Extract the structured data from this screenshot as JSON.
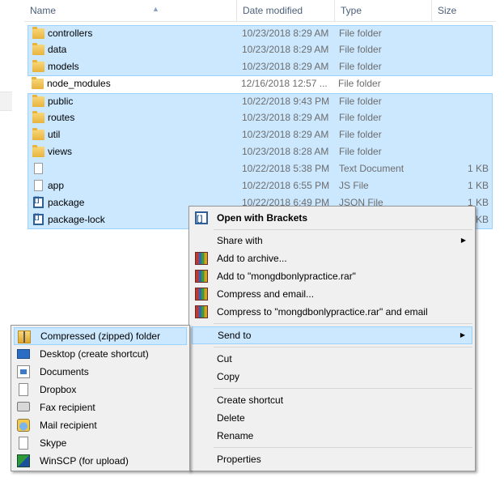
{
  "header": {
    "name": "Name",
    "date_modified": "Date modified",
    "type": "Type",
    "size": "Size"
  },
  "files": [
    {
      "name": "controllers",
      "date": "10/23/2018 8:29 AM",
      "type": "File folder",
      "size": "",
      "icon": "folder-icon",
      "selected": true
    },
    {
      "name": "data",
      "date": "10/23/2018 8:29 AM",
      "type": "File folder",
      "size": "",
      "icon": "folder-icon",
      "selected": true
    },
    {
      "name": "models",
      "date": "10/23/2018 8:29 AM",
      "type": "File folder",
      "size": "",
      "icon": "folder-icon",
      "selected": true
    },
    {
      "name": "node_modules",
      "date": "12/16/2018 12:57 ...",
      "type": "File folder",
      "size": "",
      "icon": "folder-icon",
      "selected": false
    },
    {
      "name": "public",
      "date": "10/22/2018 9:43 PM",
      "type": "File folder",
      "size": "",
      "icon": "folder-icon",
      "selected": true
    },
    {
      "name": "routes",
      "date": "10/23/2018 8:29 AM",
      "type": "File folder",
      "size": "",
      "icon": "folder-icon",
      "selected": true
    },
    {
      "name": "util",
      "date": "10/23/2018 8:29 AM",
      "type": "File folder",
      "size": "",
      "icon": "folder-icon",
      "selected": true
    },
    {
      "name": "views",
      "date": "10/23/2018 8:28 AM",
      "type": "File folder",
      "size": "",
      "icon": "folder-icon",
      "selected": true
    },
    {
      "name": "",
      "date": "10/22/2018 5:38 PM",
      "type": "Text Document",
      "size": "1 KB",
      "icon": "text-document-icon",
      "selected": true
    },
    {
      "name": "app",
      "date": "10/22/2018 6:55 PM",
      "type": "JS File",
      "size": "1 KB",
      "icon": "js-file-icon",
      "selected": true
    },
    {
      "name": "package",
      "date": "10/22/2018 6:49 PM",
      "type": "JSON File",
      "size": "1 KB",
      "icon": "brackets-file-icon",
      "selected": true
    },
    {
      "name": "package-lock",
      "date": "",
      "type": "",
      "size": "6 KB",
      "icon": "brackets-file-icon",
      "selected": true
    }
  ],
  "context_menu": {
    "open_with": "Open with Brackets",
    "share_with": "Share with",
    "add_to_archive": "Add to archive...",
    "add_to_rar": "Add to \"mongdbonlypractice.rar\"",
    "compress_email": "Compress and email...",
    "compress_rar_email": "Compress to \"mongdbonlypractice.rar\" and email",
    "send_to": "Send to",
    "cut": "Cut",
    "copy": "Copy",
    "create_shortcut": "Create shortcut",
    "delete": "Delete",
    "rename": "Rename",
    "properties": "Properties",
    "submenu_arrow": "▶"
  },
  "send_to_menu": {
    "zip": "Compressed (zipped) folder",
    "desktop": "Desktop (create shortcut)",
    "documents": "Documents",
    "dropbox": "Dropbox",
    "fax": "Fax recipient",
    "mail": "Mail recipient",
    "skype": "Skype",
    "winscp": "WinSCP (for upload)"
  },
  "colors": {
    "selection_fill": "#cce8ff",
    "selection_border": "#99d1ff",
    "menu_bg": "#f0f0f0"
  }
}
